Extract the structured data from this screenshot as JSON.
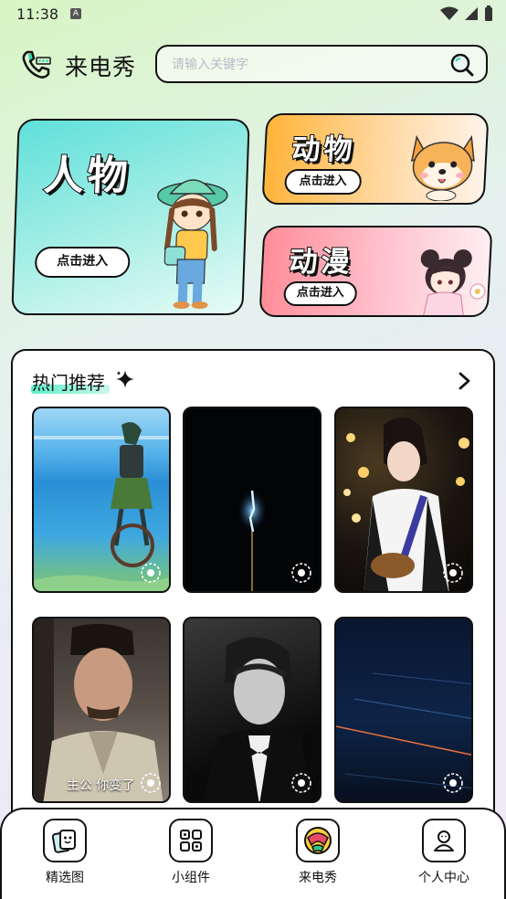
{
  "status_bar": {
    "time": "11:38",
    "badge": "A"
  },
  "header": {
    "title": "来电秀",
    "search_placeholder": "请输入关键字"
  },
  "categories": [
    {
      "title": "人物",
      "button": "点击进入"
    },
    {
      "title": "动物",
      "button": "点击进入"
    },
    {
      "title": "动漫",
      "button": "点击进入"
    }
  ],
  "hot": {
    "title": "热门推荐",
    "items": [
      {
        "caption": ""
      },
      {
        "caption": ""
      },
      {
        "caption": ""
      },
      {
        "caption": "主公 你变了"
      },
      {
        "caption": ""
      },
      {
        "caption": ""
      }
    ]
  },
  "nav": [
    {
      "label": "精选图",
      "icon": "cards-icon"
    },
    {
      "label": "小组件",
      "icon": "widgets-icon"
    },
    {
      "label": "来电秀",
      "icon": "caller-show-icon"
    },
    {
      "label": "个人中心",
      "icon": "profile-icon"
    }
  ],
  "colors": {
    "accent_teal": "#5fe0da",
    "accent_orange": "#ffb43a",
    "accent_pink": "#ff8d98",
    "highlight_green": "#5ef0c8"
  }
}
